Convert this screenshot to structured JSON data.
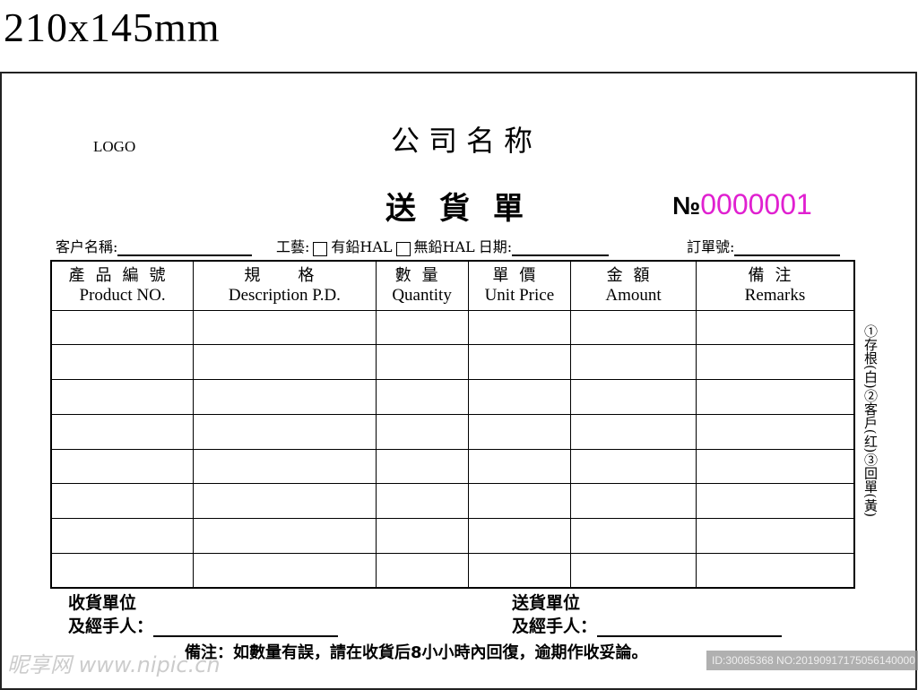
{
  "size_label": "210x145mm",
  "logo": "LOGO",
  "company": "公司名称",
  "title": "送貨單",
  "number": {
    "label": "№",
    "value": "0000001",
    "color": "#e020d0"
  },
  "fields": {
    "customer": "客户名稱:",
    "craft": "工藝:",
    "leaded": "有鉛HAL",
    "lead_free": "無鉛HAL",
    "date": "日期:",
    "order_no": "訂單號:"
  },
  "table": {
    "headers": [
      {
        "cn": "產品編號",
        "en": "Product NO."
      },
      {
        "cn": "規　格",
        "en": "Description P.D."
      },
      {
        "cn": "數量",
        "en": "Quantity"
      },
      {
        "cn": "單價",
        "en": "Unit Price"
      },
      {
        "cn": "金額",
        "en": "Amount"
      },
      {
        "cn": "備注",
        "en": "Remarks"
      }
    ],
    "row_count": 8
  },
  "side_note": "①存根(白)②客戶(红)③回單(黃)",
  "receiver": {
    "line1": "收貨單位",
    "line2": "及經手人："
  },
  "sender": {
    "line1": "送貨單位",
    "line2": "及經手人："
  },
  "note": "備注：如數量有誤，請在收貨后8小小時內回復，逾期作收妥論。",
  "watermark": {
    "site": "昵享网 www.nipic.cn",
    "id": "ID:30085368 NO:20190917175056140000"
  }
}
